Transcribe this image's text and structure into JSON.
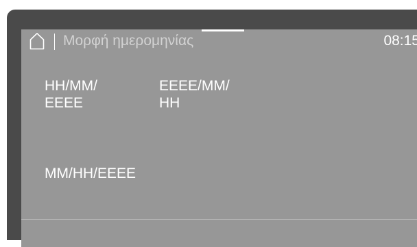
{
  "header": {
    "home_icon": "home-icon",
    "title": "Μορφή ημερομηνίας",
    "time": "08:15"
  },
  "options": [
    {
      "line1": "HH/MM/",
      "line2": "EEEE"
    },
    {
      "line1": "EEEE/MM/",
      "line2": "HH"
    },
    {
      "line1": "MM/HH/EEEE"
    }
  ],
  "colors": {
    "screen_background": "#979797",
    "bezel": "#4a4a4a",
    "text": "#ffffff",
    "title_text": "#d2d2d2"
  }
}
